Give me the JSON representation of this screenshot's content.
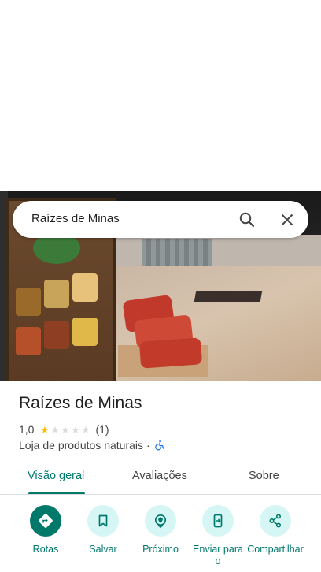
{
  "search": {
    "value": "Raízes de Minas"
  },
  "place": {
    "name": "Raízes de Minas",
    "rating": "1,0",
    "rating_value": 1,
    "rating_max": 5,
    "review_count": "(1)",
    "category": "Loja de produtos naturais",
    "separator": "·"
  },
  "tabs": [
    {
      "label": "Visão geral",
      "active": true
    },
    {
      "label": "Avaliações",
      "active": false
    },
    {
      "label": "Sobre",
      "active": false
    }
  ],
  "actions": [
    {
      "label": "Rotas",
      "icon": "directions-icon"
    },
    {
      "label": "Salvar",
      "icon": "bookmark-icon"
    },
    {
      "label": "Próximo",
      "icon": "nearby-icon"
    },
    {
      "label": "Enviar para o",
      "icon": "send-to-phone-icon"
    },
    {
      "label": "Compartilhar",
      "icon": "share-icon"
    }
  ],
  "colors": {
    "accent": "#00796b",
    "chip": "#d6f6f6",
    "star": "#fbbc04"
  }
}
